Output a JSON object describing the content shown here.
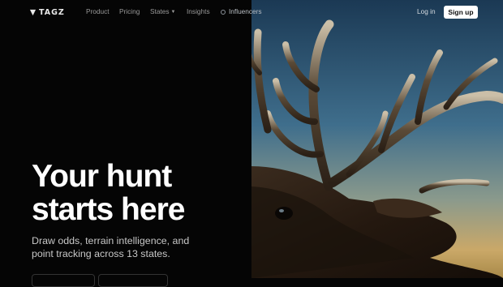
{
  "brand": {
    "name": "TAGZ"
  },
  "nav": {
    "items": [
      {
        "label": "Product"
      },
      {
        "label": "Pricing"
      },
      {
        "label": "States"
      },
      {
        "label": "Insights"
      },
      {
        "label": "Influencers"
      }
    ],
    "states_chevron": "chevron-down-icon"
  },
  "auth": {
    "login_label": "Log in",
    "signup_label": "Sign up"
  },
  "hero": {
    "headline_line1": "Your hunt",
    "headline_line2": "starts here",
    "subhead_line1": "Draw odds, terrain intelligence, and",
    "subhead_line2": "point tracking across 13 states."
  },
  "colors": {
    "background": "#050505",
    "signup_bg": "#ffffff",
    "nav_text": "#9a9a9a",
    "sky_top": "#1f3d59",
    "sky_bottom": "#b7a36e"
  }
}
